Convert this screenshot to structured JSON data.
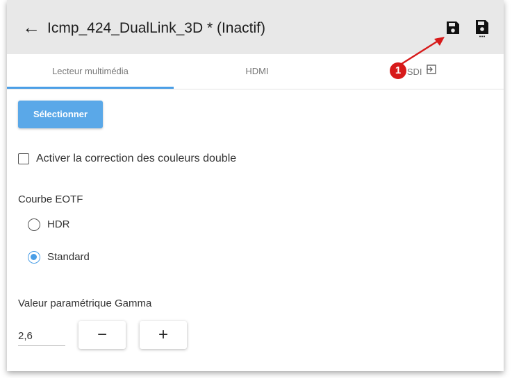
{
  "header": {
    "back_glyph": "←",
    "title": "Icmp_424_DualLink_3D * (Inactif)",
    "save_icon": "save-icon",
    "save_as_icon": "save-as-icon"
  },
  "tabs": [
    {
      "label": "Lecteur multimédia",
      "active": true
    },
    {
      "label": "HDMI",
      "active": false
    },
    {
      "label": "SDI",
      "active": false
    }
  ],
  "annotation": {
    "badge": "1",
    "color": "#d71a1a"
  },
  "content": {
    "select_button": "Sélectionner",
    "dual_color_correction": {
      "label": "Activer la correction des couleurs double",
      "checked": false
    },
    "eotf": {
      "label": "Courbe EOTF",
      "options": [
        {
          "label": "HDR",
          "selected": false
        },
        {
          "label": "Standard",
          "selected": true
        }
      ]
    },
    "gamma": {
      "label": "Valeur paramétrique Gamma",
      "value": "2,6",
      "minus": "−",
      "plus": "+"
    }
  },
  "colors": {
    "accent": "#4a9ee6",
    "header_bg": "#e8e8e8",
    "button_bg": "#5aa8e8"
  }
}
